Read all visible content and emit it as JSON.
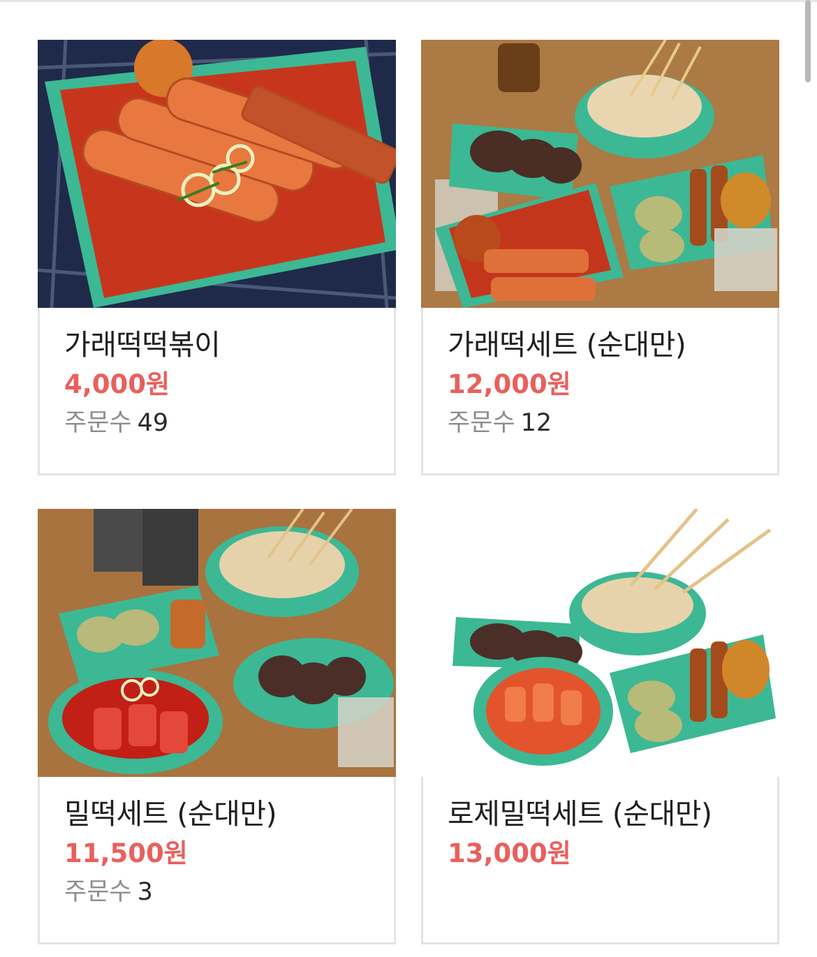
{
  "menu": {
    "items": [
      {
        "name": "가래떡떡볶이",
        "price": "4,000원",
        "orders_label": "주문수",
        "orders_count": "49",
        "image_icon": "tteokbokki-photo"
      },
      {
        "name": "가래떡세트 (순대만)",
        "price": "12,000원",
        "orders_label": "주문수",
        "orders_count": "12",
        "image_icon": "tteok-set-photo"
      },
      {
        "name": "밀떡세트 (순대만)",
        "price": "11,500원",
        "orders_label": "주문수",
        "orders_count": "3",
        "image_icon": "milltteok-set-photo"
      },
      {
        "name": "로제밀떡세트 (순대만)",
        "price": "13,000원",
        "image_icon": "rose-milltteok-set-photo"
      }
    ]
  },
  "colors": {
    "price": "#e9605c",
    "card_border": "#e3e3e3",
    "bowl": "#3cb894",
    "sauce": "#d2391e"
  }
}
